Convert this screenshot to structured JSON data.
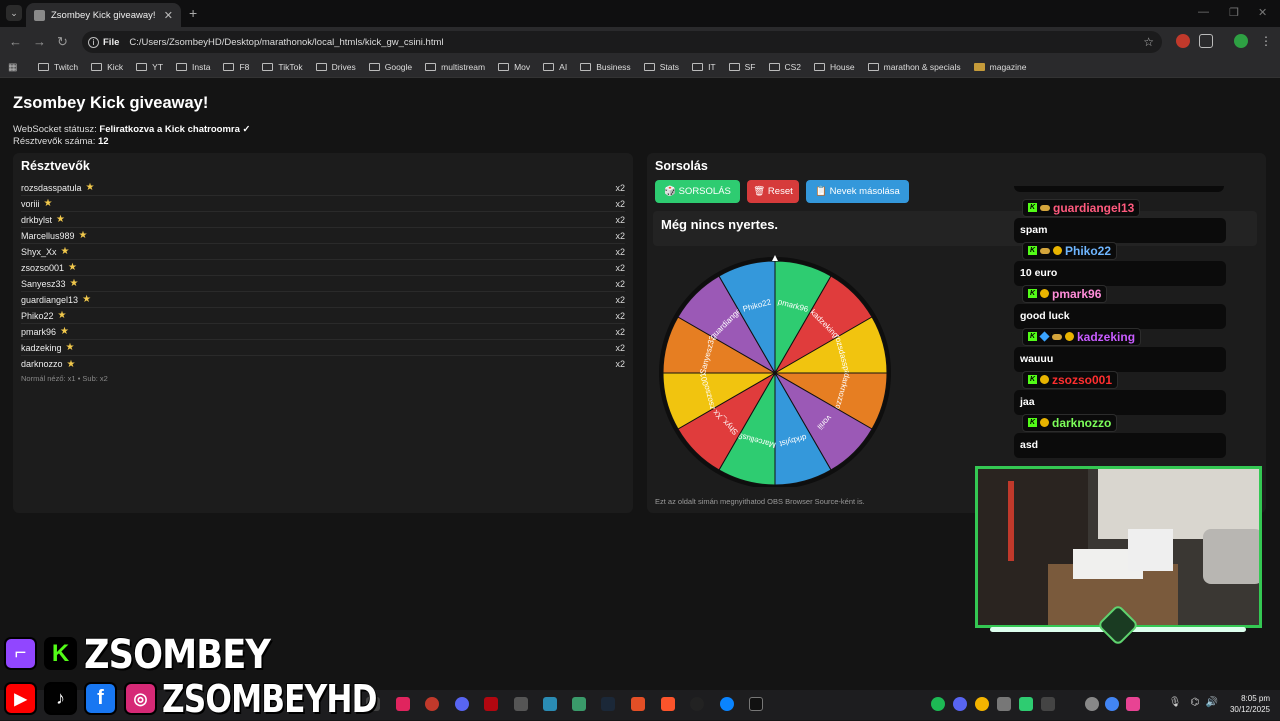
{
  "browser": {
    "tab_title": "Zsombey Kick giveaway!",
    "scheme_label": "File",
    "url": "C:/Users/ZsombeyHD/Desktop/marathonok/local_htmls/kick_gw_csini.html",
    "bookmarks": [
      "Twitch",
      "Kick",
      "YT",
      "Insta",
      "F8",
      "TikTok",
      "Drives",
      "Google",
      "multistream",
      "Mov",
      "AI",
      "Business",
      "Stats",
      "IT",
      "SF",
      "CS2",
      "House",
      "marathon & specials",
      "magazine"
    ]
  },
  "page": {
    "title": "Zsombey Kick giveaway!",
    "ws_label": "WebSocket státusz:",
    "ws_value": "Feliratkozva a Kick chatroomra ✓",
    "count_label": "Résztvevők száma:",
    "count_value": "12"
  },
  "participants": {
    "title": "Résztvevők",
    "items": [
      {
        "name": "rozsdasspatula",
        "mult": "x2"
      },
      {
        "name": "voriii",
        "mult": "x2"
      },
      {
        "name": "drkbylst",
        "mult": "x2"
      },
      {
        "name": "Marcellus989",
        "mult": "x2"
      },
      {
        "name": "Shyx_Xx",
        "mult": "x2"
      },
      {
        "name": "zsozso001",
        "mult": "x2"
      },
      {
        "name": "Sanyesz33",
        "mult": "x2"
      },
      {
        "name": "guardiangel13",
        "mult": "x2"
      },
      {
        "name": "Phiko22",
        "mult": "x2"
      },
      {
        "name": "pmark96",
        "mult": "x2"
      },
      {
        "name": "kadzeking",
        "mult": "x2"
      },
      {
        "name": "darknozzo",
        "mult": "x2"
      }
    ],
    "note": "Normál néző: x1 • Sub: x2"
  },
  "draw": {
    "title": "Sorsolás",
    "draw_button": "🎲 SORSOLÁS",
    "reset_button": "🗑 Reset",
    "copy_button": "📋 Nevek másolása",
    "winner_text": "Még nincs nyertes.",
    "obs_note": "Ezt az oldalt simán megnyithatod OBS Browser Source-ként is."
  },
  "wheel": {
    "segments": [
      {
        "label": "pmark96",
        "color": "#2ecc71"
      },
      {
        "label": "kadzeking",
        "color": "#e03c3c"
      },
      {
        "label": "rozsdasspa",
        "color": "#f1c40f"
      },
      {
        "label": "darknozzo",
        "color": "#e67e22"
      },
      {
        "label": "voriii",
        "color": "#9b59b6"
      },
      {
        "label": "drkbylst",
        "color": "#3498db"
      },
      {
        "label": "Marcellus9",
        "color": "#2ecc71"
      },
      {
        "label": "Shyx_Xx",
        "color": "#e03c3c"
      },
      {
        "label": "zsozso001",
        "color": "#f1c40f"
      },
      {
        "label": "Sanyesz33",
        "color": "#e67e22"
      },
      {
        "label": "guardiange",
        "color": "#9b59b6"
      },
      {
        "label": "Phiko22",
        "color": "#3498db"
      }
    ]
  },
  "chat": {
    "messages": [
      {
        "user": "guardiangel13",
        "text": "spam",
        "color": "#ff5a7e"
      },
      {
        "user": "Phiko22",
        "text": "10 euro",
        "color": "#6fb6ff"
      },
      {
        "user": "pmark96",
        "text": "good luck",
        "color": "#ff8dd9"
      },
      {
        "user": "kadzeking",
        "text": "wauuu",
        "color": "#c85cff"
      },
      {
        "user": "zsozso001",
        "text": "jaa",
        "color": "#ff2f2f"
      },
      {
        "user": "darknozzo",
        "text": "asd",
        "color": "#7dff5a"
      }
    ]
  },
  "overlay": {
    "brand_top": "ZSOMBEY",
    "brand_bottom": "ZSOMBEYHD"
  },
  "taskbar": {
    "time": "8:05 pm",
    "date": "30/12/2025"
  }
}
